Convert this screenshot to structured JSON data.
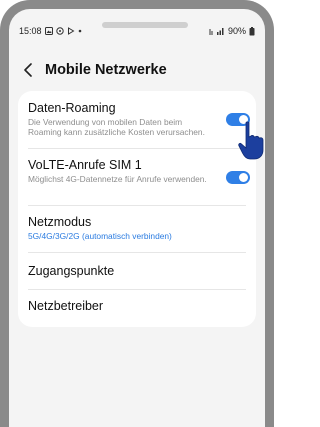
{
  "status_bar": {
    "time": "15:08",
    "battery": "90%",
    "icons": [
      "gallery-icon",
      "whatsapp-icon",
      "play-icon",
      "dot-icon",
      "signal-icon",
      "battery-icon"
    ]
  },
  "header": {
    "back_icon": "chevron-left-icon",
    "title": "Mobile Netzwerke"
  },
  "settings": [
    {
      "title": "Daten-Roaming",
      "subtitle": "Die Verwendung von mobilen Daten beim Roaming kann zusätzliche Kosten verursachen.",
      "toggle": true
    },
    {
      "title": "VoLTE-Anrufe SIM 1",
      "subtitle": "Möglichst 4G-Datennetze für Anrufe verwenden.",
      "toggle": true
    },
    {
      "title": "Netzmodus",
      "subtitle": "5G/4G/3G/2G (automatisch verbinden)"
    },
    {
      "title": "Zugangspunkte"
    },
    {
      "title": "Netzbetreiber"
    }
  ],
  "colors": {
    "accent": "#2f7fe6",
    "hand": "#1c3f9e"
  }
}
